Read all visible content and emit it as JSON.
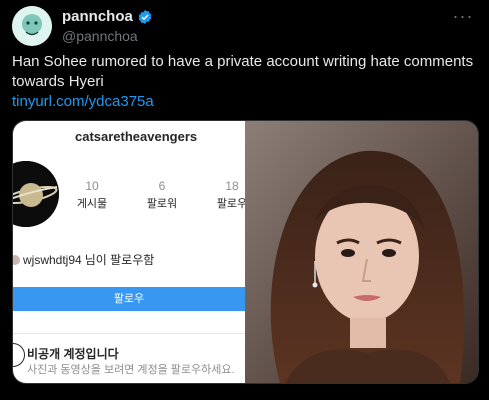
{
  "tweet": {
    "display_name": "pannchoa",
    "handle": "@pannchoa",
    "text": "Han Sohee rumored to have a private account writing hate comments towards Hyeri",
    "link": "tinyurl.com/ydca375a",
    "more_icon": "ellipsis-icon",
    "verified_icon": "verified-badge-icon",
    "link_color": "#1d9bf0"
  },
  "media": {
    "instagram": {
      "username": "catsaretheavengers",
      "stats": [
        {
          "num": "10",
          "label": "게시물"
        },
        {
          "num": "6",
          "label": "팔로워"
        },
        {
          "num": "18",
          "label": "팔로우"
        }
      ],
      "followed_by_user": "wjswhdtj94",
      "followed_by_suffix": "님이 팔로우함",
      "follow_button": "팔로우",
      "private_title": "비공개 계정입니다",
      "private_desc": "사진과 동영상을 보려면 계정을 팔로우하세요."
    }
  }
}
